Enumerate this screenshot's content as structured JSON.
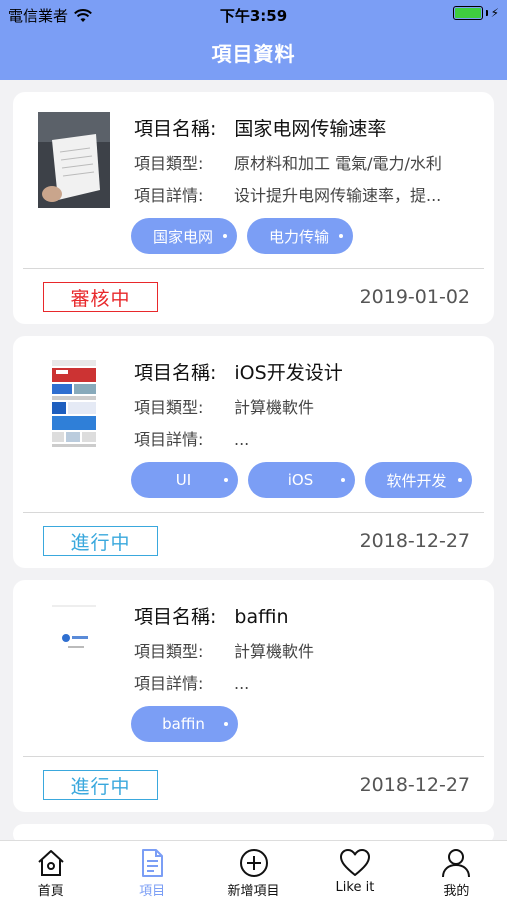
{
  "status_bar": {
    "carrier": "電信業者",
    "time": "下午3:59"
  },
  "nav": {
    "title": "項目資料"
  },
  "labels": {
    "name": "項目名稱:",
    "type": "項目類型:",
    "detail": "項目詳情:"
  },
  "projects": [
    {
      "name": "国家电网传输速率",
      "type": "原材料和加工 電氣/電力/水利",
      "detail": "设计提升电网传输速率，提...",
      "tags": [
        "国家电网",
        "电力传输"
      ],
      "status": "審核中",
      "status_color": "#e8282b",
      "date": "2019-01-02"
    },
    {
      "name": "iOS开发设计",
      "type": "計算機軟件",
      "detail": "...",
      "tags": [
        "UI",
        "iOS",
        "软件开发"
      ],
      "status": "進行中",
      "status_color": "#3aa8dd",
      "date": "2018-12-27"
    },
    {
      "name": "baffin",
      "type": "計算機軟件",
      "detail": "...",
      "tags": [
        "baffin"
      ],
      "status": "進行中",
      "status_color": "#3aa8dd",
      "date": "2018-12-27"
    }
  ],
  "tabbar": [
    {
      "label": "首頁",
      "icon": "home-icon",
      "active": false
    },
    {
      "label": "項目",
      "icon": "document-icon",
      "active": true
    },
    {
      "label": "新增項目",
      "icon": "add-circle-icon",
      "active": false
    },
    {
      "label": "Like it",
      "icon": "heart-icon",
      "active": false
    },
    {
      "label": "我的",
      "icon": "person-icon",
      "active": false
    }
  ],
  "colors": {
    "accent": "#7b9ef5",
    "background": "#f2f2f4"
  }
}
